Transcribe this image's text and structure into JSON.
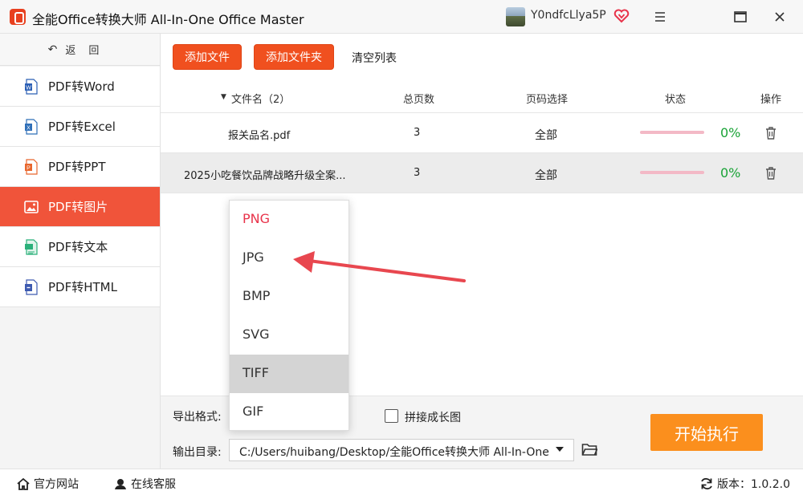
{
  "window": {
    "title": "全能Office转换大师 All-In-One Office Master",
    "username": "Y0ndfcLlya5P"
  },
  "sidebar": {
    "back_label": "返回",
    "items": [
      {
        "label": "PDF转Word",
        "icon": "word-doc-icon",
        "color": "#2b5fb5"
      },
      {
        "label": "PDF转Excel",
        "icon": "excel-doc-icon",
        "color": "#2f6fb8"
      },
      {
        "label": "PDF转PPT",
        "icon": "ppt-doc-icon",
        "color": "#e8662d"
      },
      {
        "label": "PDF转图片",
        "icon": "image-doc-icon",
        "color": "#ffffff"
      },
      {
        "label": "PDF转文本",
        "icon": "text-doc-icon",
        "color": "#2bb07a"
      },
      {
        "label": "PDF转HTML",
        "icon": "html-doc-icon",
        "color": "#3d5ab0"
      }
    ],
    "active_index": 3
  },
  "toolbar": {
    "add_file": "添加文件",
    "add_folder": "添加文件夹",
    "clear_list": "清空列表"
  },
  "table": {
    "headers": {
      "filename": "文件名（2）",
      "pages": "总页数",
      "page_select": "页码选择",
      "status": "状态",
      "actions": "操作"
    },
    "rows": [
      {
        "filename": "报关品名.pdf",
        "pages": "3",
        "page_select": "全部",
        "progress": "0%"
      },
      {
        "filename": "2025小吃餐饮品牌战略升级全案...",
        "pages": "3",
        "page_select": "全部",
        "progress": "0%"
      }
    ]
  },
  "format_dropdown": {
    "options": [
      "PNG",
      "JPG",
      "BMP",
      "SVG",
      "TIFF",
      "GIF"
    ],
    "selected": "PNG",
    "hovered": "TIFF"
  },
  "bottom": {
    "export_format_label": "导出格式:",
    "merge_long_image_label": "拼接成长图",
    "output_dir_label": "输出目录:",
    "output_dir_value": "C:/Users/huibang/Desktop/全能Office转换大师 All-In-One",
    "start_button": "开始执行"
  },
  "statusbar": {
    "official_site": "官方网站",
    "online_service": "在线客服",
    "version": "版本：1.0.2.0"
  },
  "colors": {
    "accent_red": "#f0501f",
    "active_nav": "#f0543a",
    "start_orange": "#fb8f1d",
    "progress_green": "#1aa337",
    "selected_option": "#e8334a",
    "arrow_annotation": "#e8474f"
  }
}
